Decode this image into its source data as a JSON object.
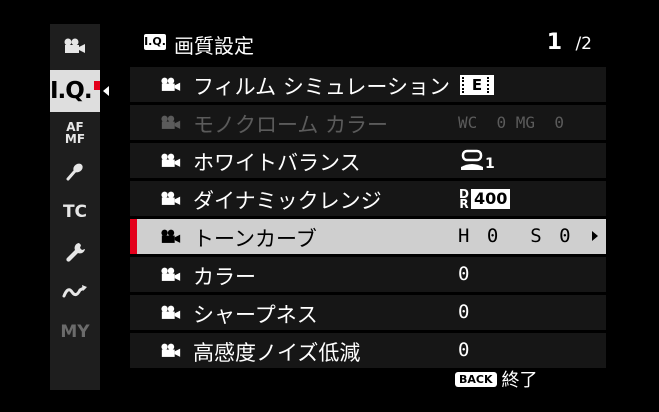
{
  "sidebar": {
    "items": [
      {
        "name": "movie",
        "icon": "movie-camera-icon"
      },
      {
        "name": "image-quality",
        "label": "I.Q.",
        "active": true
      },
      {
        "name": "af-mf",
        "label_top": "AF",
        "label_bottom": "MF"
      },
      {
        "name": "audio",
        "icon": "microphone-icon"
      },
      {
        "name": "tc",
        "label": "TC"
      },
      {
        "name": "setup",
        "icon": "wrench-icon"
      },
      {
        "name": "connection",
        "icon": "wave-icon"
      },
      {
        "name": "my-menu",
        "label": "MY"
      }
    ]
  },
  "header": {
    "icon_label": "I.Q.",
    "title": "画質設定",
    "page": "1",
    "page_total": "/2"
  },
  "rows": [
    {
      "label": "フィルム シミュレーション",
      "value": "E"
    },
    {
      "label": "モノクローム カラー",
      "value": "WC  0 MG  0"
    },
    {
      "label": "ホワイトバランス",
      "value": "1"
    },
    {
      "label": "ダイナミックレンジ",
      "value_prefix": "D R",
      "value": "400"
    },
    {
      "label": "トーンカーブ",
      "value": "H 0  S 0"
    },
    {
      "label": "カラー",
      "value": "0"
    },
    {
      "label": "シャープネス",
      "value": "0"
    },
    {
      "label": "高感度ノイズ低減",
      "value": "0"
    }
  ],
  "footer": {
    "back_label": "BACK",
    "action_label": "終了"
  },
  "colors": {
    "accent_red": "#e3001b",
    "selected_bg": "#cfcfcf",
    "row_bg": "#161616",
    "sidebar_bg": "#1e1e1e"
  }
}
